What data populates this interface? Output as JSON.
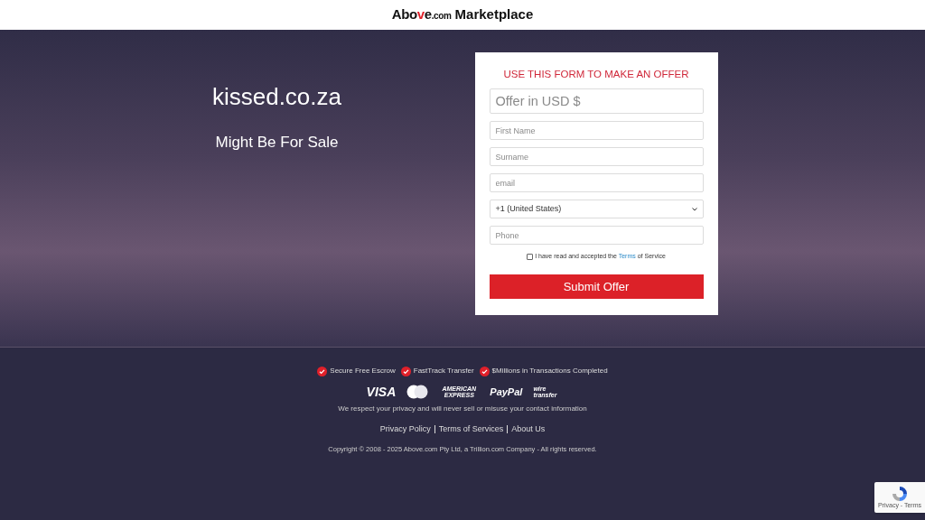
{
  "header": {
    "logo": [
      {
        "kind": "plain",
        "text": "Abo"
      },
      {
        "kind": "accent",
        "text": "v"
      },
      {
        "kind": "plain",
        "text": "e"
      },
      {
        "kind": "small",
        "text": ".com"
      }
    ],
    "title": "Marketplace"
  },
  "domain": "kissed.co.za",
  "subtitle": "Might Be For Sale",
  "form": {
    "heading": "USE THIS FORM TO MAKE AN OFFER",
    "offer_placeholder": "Offer in USD $",
    "fields": [
      {
        "placeholder": "First Name"
      },
      {
        "placeholder": "Surname"
      },
      {
        "placeholder": "email"
      }
    ],
    "country_select": "+1 (United States)",
    "phone_placeholder": "Phone",
    "terms": {
      "checked": false,
      "before": "I have read and accepted the",
      "link": "Terms",
      "after": "of Service"
    },
    "submit": "Submit Offer"
  },
  "features": [
    "Secure Free Escrow",
    "FastTrack Transfer",
    "$Millions in Transactions Completed"
  ],
  "payment_marks": [
    {
      "kind": "visa",
      "text": "VISA"
    },
    {
      "kind": "mastercard"
    },
    {
      "kind": "amex",
      "text": "AMERICAN EXPRESS"
    },
    {
      "kind": "paypal",
      "text": "PayPal"
    },
    {
      "kind": "wire",
      "text": "wire transfer"
    }
  ],
  "privacy_note": "We respect your privacy and will never sell or misuse your contact information",
  "footer_links": [
    "Privacy Policy",
    "Terms of Services",
    "About Us"
  ],
  "copyright": "Copyright © 2008 - 2025 Above.com Pty Ltd, a Trillion.com Company - All rights reserved.",
  "recaptcha": {
    "text": "Privacy - Terms"
  }
}
